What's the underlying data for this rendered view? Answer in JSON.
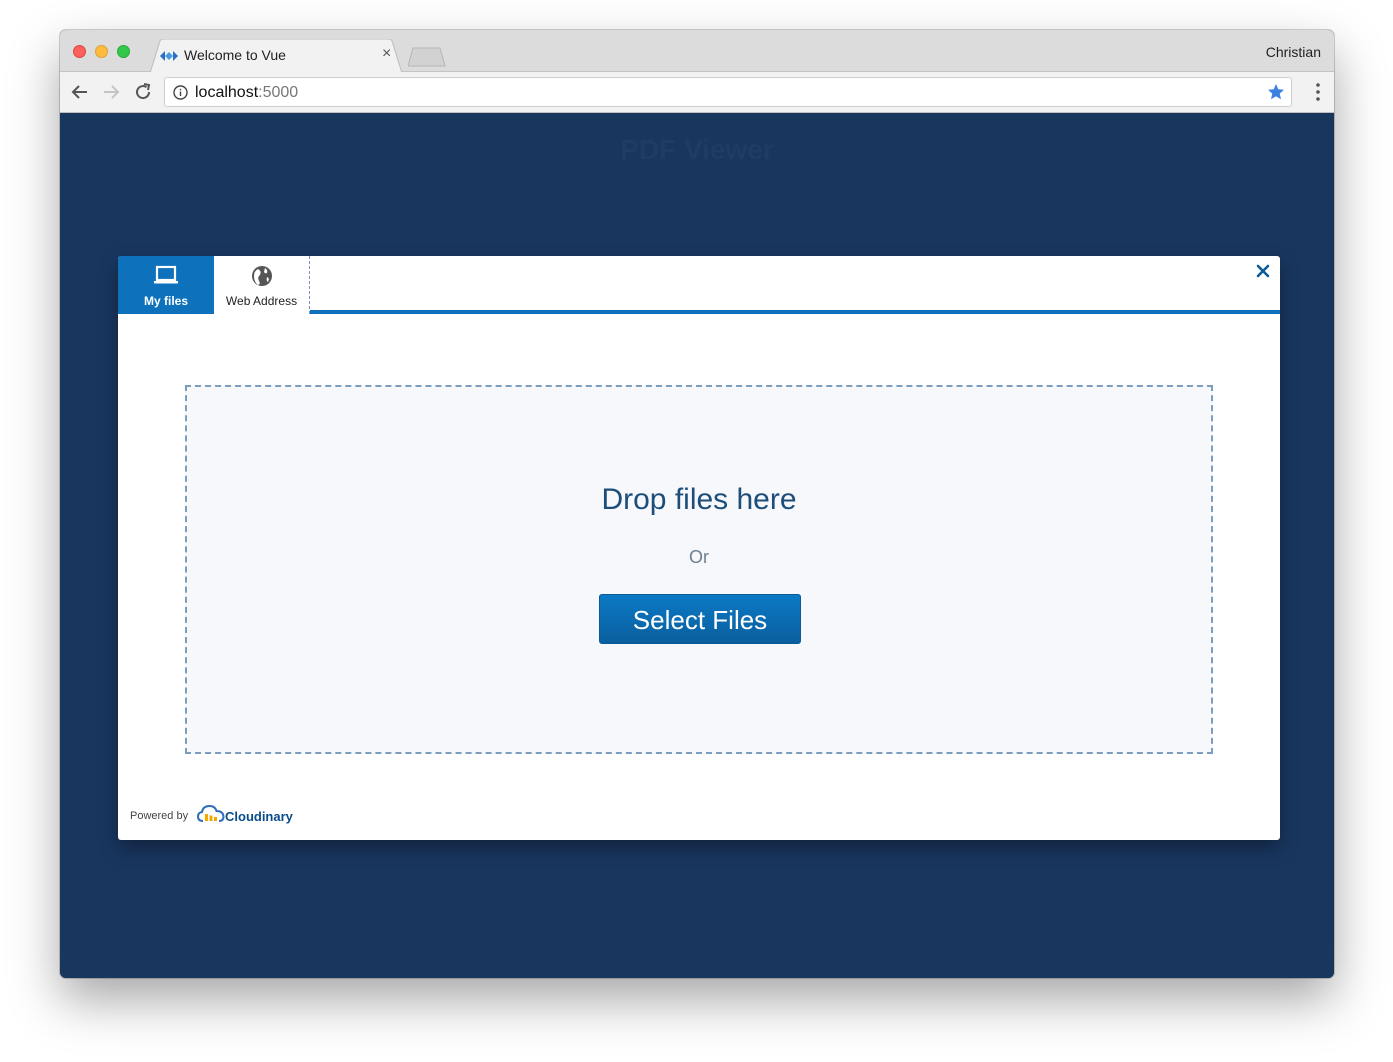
{
  "browser": {
    "tab_title": "Welcome to Vue",
    "tab_close": "×",
    "profile_name": "Christian",
    "url_host": "localhost",
    "url_port": ":5000"
  },
  "page": {
    "title": "PDF Viewer"
  },
  "widget": {
    "tabs": [
      {
        "label": "My files",
        "icon": "laptop-icon",
        "active": true
      },
      {
        "label": "Web Address",
        "icon": "globe-icon",
        "active": false
      }
    ],
    "dropzone": {
      "title": "Drop files here",
      "or": "Or",
      "button": "Select Files"
    },
    "footer": {
      "powered_by": "Powered by",
      "brand": "Cloudinary"
    }
  },
  "colors": {
    "page_bg": "#19365f",
    "accent": "#0d72bb",
    "drop_title": "#1d4e79"
  }
}
